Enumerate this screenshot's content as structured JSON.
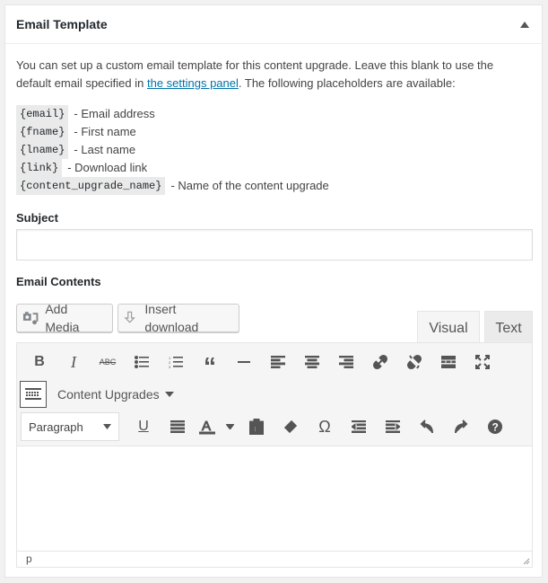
{
  "panel": {
    "title": "Email Template",
    "intro_before": "You can set up a custom email template for this content upgrade. Leave this blank to use the default email specified in ",
    "intro_link": "the settings panel",
    "intro_after": ". The following placeholders are available:",
    "placeholders": [
      {
        "code": "{email}",
        "desc": "- Email address"
      },
      {
        "code": "{fname}",
        "desc": "- First name"
      },
      {
        "code": "{lname}",
        "desc": "- Last name"
      },
      {
        "code": "{link}",
        "desc": "- Download link"
      },
      {
        "code": "{content_upgrade_name}",
        "desc": "- Name of the content upgrade"
      }
    ],
    "subject_label": "Subject",
    "subject_value": "",
    "contents_label": "Email Contents"
  },
  "editor": {
    "add_media": "Add Media",
    "insert_download": "Insert download",
    "tab_visual": "Visual",
    "tab_text": "Text",
    "content_upgrades": "Content Upgrades",
    "format_select": "Paragraph",
    "status_path": "p",
    "icons_row1": [
      "bold-icon",
      "italic-icon",
      "strikethrough-icon",
      "bullet-list-icon",
      "numbered-list-icon",
      "blockquote-icon",
      "horizontal-line-icon",
      "align-left-icon",
      "align-center-icon",
      "align-right-icon",
      "link-icon",
      "unlink-icon",
      "read-more-icon",
      "fullscreen-icon"
    ],
    "icons_row3": [
      "underline-icon",
      "justify-icon",
      "text-color-icon",
      "paste-text-icon",
      "clear-formatting-icon",
      "special-character-icon",
      "outdent-icon",
      "indent-icon",
      "undo-icon",
      "redo-icon",
      "help-icon"
    ]
  }
}
